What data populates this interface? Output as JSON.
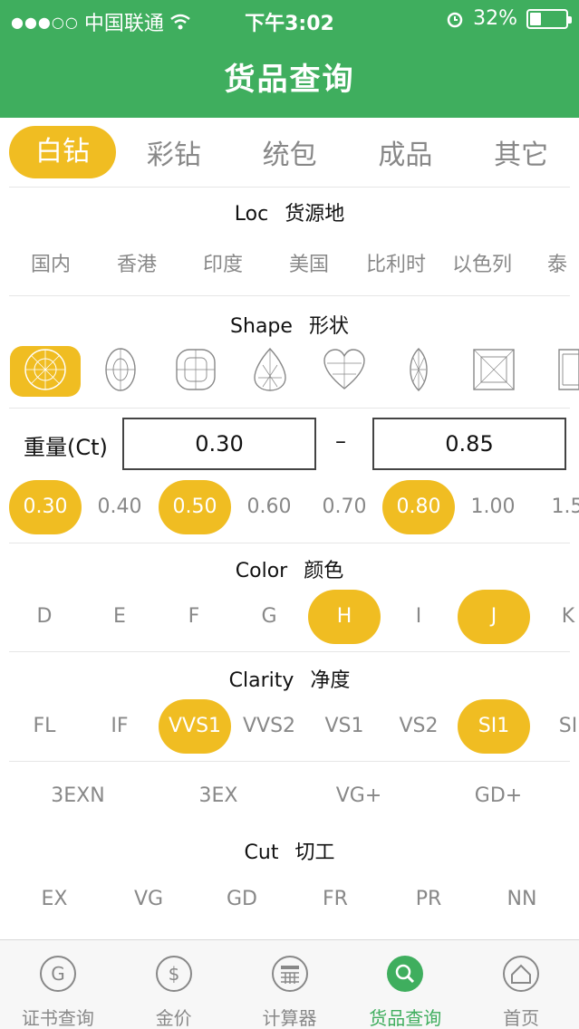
{
  "status_bar": {
    "carrier": "中国联通",
    "time": "下午3:02",
    "battery": "32%",
    "battery_level": 0.32
  },
  "header": {
    "title": "货品查询"
  },
  "category_tabs": [
    {
      "label": "白钻",
      "active": true
    },
    {
      "label": "彩钻",
      "active": false
    },
    {
      "label": "统包",
      "active": false
    },
    {
      "label": "成品",
      "active": false
    },
    {
      "label": "其它",
      "active": false
    }
  ],
  "loc": {
    "title_en": "Loc",
    "title_cn": "货源地",
    "options": [
      "国内",
      "香港",
      "印度",
      "美国",
      "比利时",
      "以色列",
      "泰"
    ]
  },
  "shape": {
    "title_en": "Shape",
    "title_cn": "形状",
    "icons": [
      "round-icon",
      "oval-icon",
      "cushion-icon",
      "pear-icon",
      "heart-icon",
      "marquise-icon",
      "princess-icon",
      "emerald-icon"
    ],
    "selected_index": 0
  },
  "weight": {
    "label": "重量(Ct)",
    "min": "0.30",
    "dash": "–",
    "max": "0.85",
    "presets": [
      {
        "label": "0.30",
        "selected": true
      },
      {
        "label": "0.40",
        "selected": false
      },
      {
        "label": "0.50",
        "selected": true
      },
      {
        "label": "0.60",
        "selected": false
      },
      {
        "label": "0.70",
        "selected": false
      },
      {
        "label": "0.80",
        "selected": true
      },
      {
        "label": "1.00",
        "selected": false
      },
      {
        "label": "1.5",
        "selected": false
      }
    ]
  },
  "color": {
    "title_en": "Color",
    "title_cn": "颜色",
    "options": [
      {
        "label": "D",
        "selected": false
      },
      {
        "label": "E",
        "selected": false
      },
      {
        "label": "F",
        "selected": false
      },
      {
        "label": "G",
        "selected": false
      },
      {
        "label": "H",
        "selected": true
      },
      {
        "label": "I",
        "selected": false
      },
      {
        "label": "J",
        "selected": true
      },
      {
        "label": "K",
        "selected": false
      }
    ]
  },
  "clarity": {
    "title_en": "Clarity",
    "title_cn": "净度",
    "options": [
      {
        "label": "FL",
        "selected": false
      },
      {
        "label": "IF",
        "selected": false
      },
      {
        "label": "VVS1",
        "selected": true
      },
      {
        "label": "VVS2",
        "selected": false
      },
      {
        "label": "VS1",
        "selected": false
      },
      {
        "label": "VS2",
        "selected": false
      },
      {
        "label": "SI1",
        "selected": true
      },
      {
        "label": "SI",
        "selected": false
      }
    ]
  },
  "grade_quick": [
    "3EXN",
    "3EX",
    "VG+",
    "GD+"
  ],
  "cut": {
    "title_en": "Cut",
    "title_cn": "切工",
    "options": [
      "EX",
      "VG",
      "GD",
      "FR",
      "PR",
      "NN"
    ]
  },
  "tabbar": [
    {
      "label": "证书查询",
      "icon": "certificate-icon",
      "active": false
    },
    {
      "label": "金价",
      "icon": "gold-price-icon",
      "active": false
    },
    {
      "label": "计算器",
      "icon": "calculator-icon",
      "active": false
    },
    {
      "label": "货品查询",
      "icon": "search-icon",
      "active": true
    },
    {
      "label": "首页",
      "icon": "home-icon",
      "active": false
    }
  ],
  "colors": {
    "green": "#3fae5e",
    "accent": "#f0bd22",
    "muted": "#888888"
  }
}
